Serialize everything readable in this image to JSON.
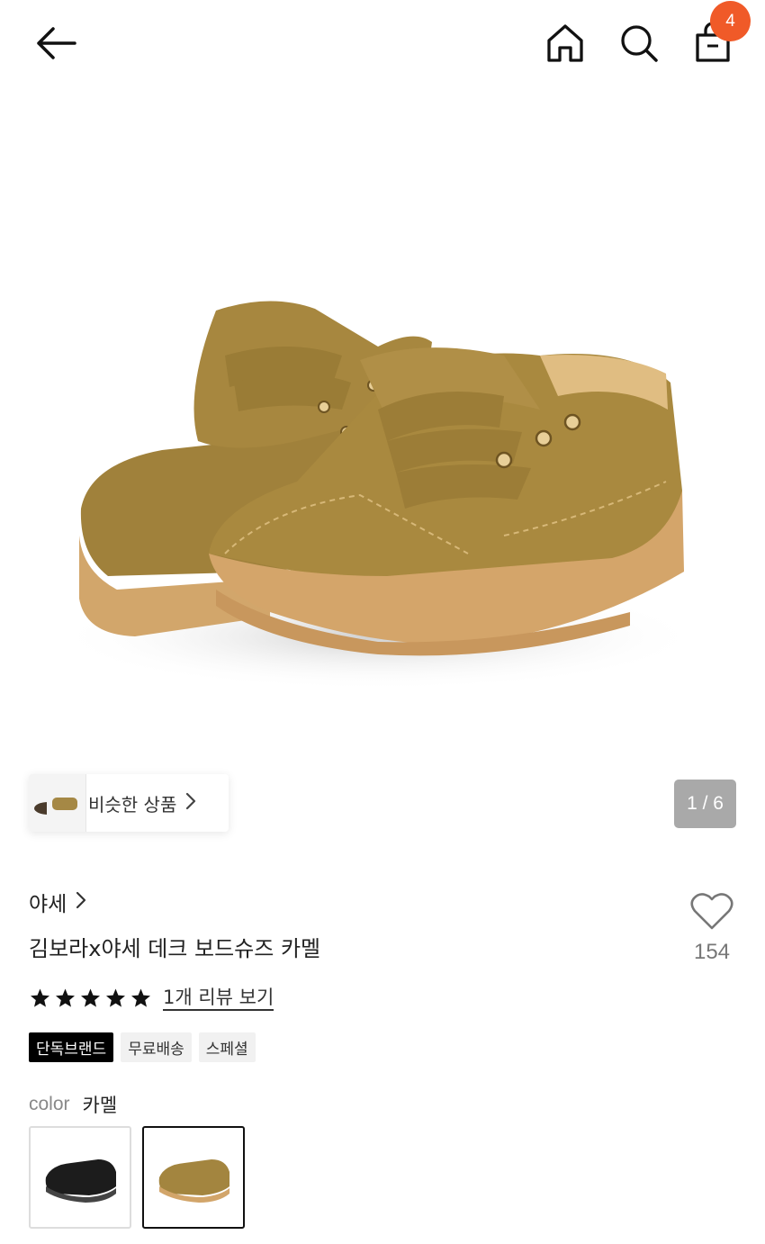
{
  "header": {
    "icons": [
      "back-arrow-icon",
      "home-icon",
      "search-icon",
      "shopping-bag-icon"
    ],
    "cart_badge": "4",
    "accent_color": "#f05a28"
  },
  "gallery": {
    "counter": "1 / 6",
    "image_subject": "camel suede chunky board sneakers"
  },
  "similar": {
    "label": "비슷한 상품"
  },
  "product": {
    "brand": "야세",
    "title": "김보라x야세 데크 보드슈즈 카멜",
    "likes": "154",
    "rating_stars": 5,
    "review_link": "1개 리뷰 보기",
    "tags": [
      "단독브랜드",
      "무료배송",
      "스페셜"
    ]
  },
  "color": {
    "label": "color",
    "selected": "카멜",
    "options": [
      "black",
      "camel"
    ]
  }
}
